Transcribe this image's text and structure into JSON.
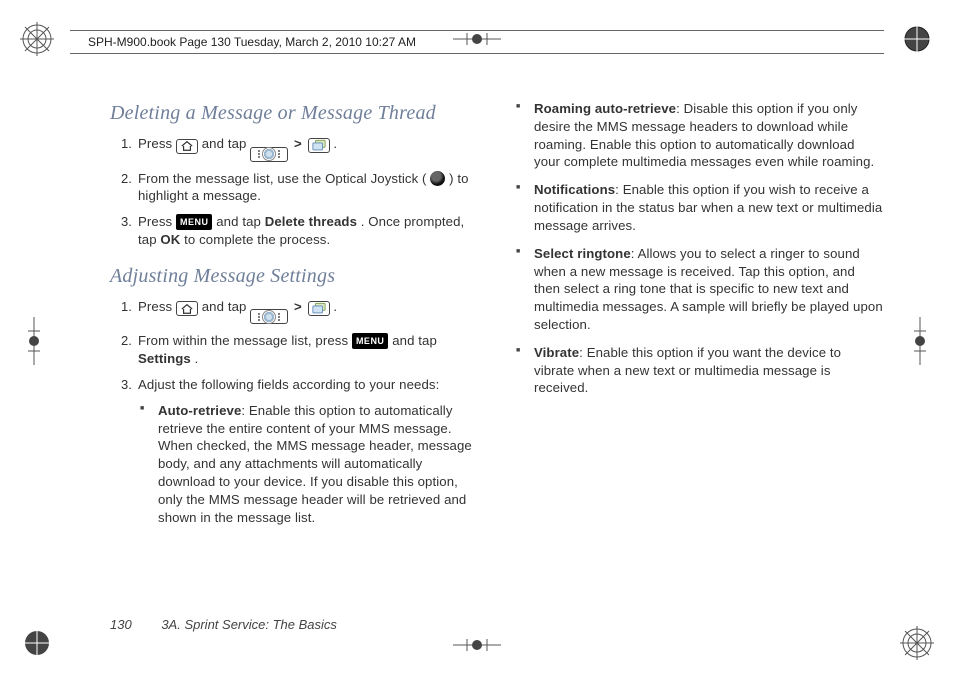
{
  "header": {
    "running_head": "SPH-M900.book  Page 130  Tuesday, March 2, 2010  10:27 AM"
  },
  "section1": {
    "title": "Deleting a Message or Message Thread",
    "steps": {
      "s1_a": "Press ",
      "s1_b": " and tap ",
      "s1_c": " > ",
      "s1_d": " .",
      "s2_a": "From the message list, use the Optical Joystick ( ",
      "s2_b": " ) to highlight a message.",
      "s3_a": "Press ",
      "s3_b": " and tap ",
      "s3_bold1": "Delete threads",
      "s3_c": ". Once prompted, tap ",
      "s3_bold2": "OK",
      "s3_d": " to complete the process."
    }
  },
  "section2": {
    "title": "Adjusting Message Settings",
    "steps": {
      "s1_a": "Press ",
      "s1_b": " and tap ",
      "s1_c": " > ",
      "s1_d": " .",
      "s2_a": "From within the message list, press ",
      "s2_b": " and tap ",
      "s2_bold": "Settings",
      "s2_c": ".",
      "s3": "Adjust the following fields according to your needs:"
    },
    "bullets_left": {
      "b1_bold": "Auto-retrieve",
      "b1_text": ": Enable this option to automatically retrieve the entire content of your MMS message. When checked, the MMS message header, message body, and any attachments will automatically download to your device. If you disable this option, only the MMS message header will be retrieved and shown in the message list."
    }
  },
  "right_bullets": {
    "b1_bold": "Roaming auto-retrieve",
    "b1_text": ": Disable this option if you only desire the MMS message headers to download while roaming. Enable this option to automatically download your complete multimedia messages even while roaming.",
    "b2_bold": "Notifications",
    "b2_text": ": Enable this option if you wish to receive a notification in the status bar when a new text or multimedia message arrives.",
    "b3_bold": "Select ringtone",
    "b3_text": ": Allows you to select a ringer to sound when a new message is received. Tap this option, and then select a ring tone that is specific to new text and multimedia messages. A sample will briefly be played upon selection.",
    "b4_bold": "Vibrate",
    "b4_text": ": Enable this option if you want the device to vibrate when a new text or multimedia message is received."
  },
  "footer": {
    "page_number": "130",
    "title": "3A. Sprint Service: The Basics"
  },
  "labels": {
    "menu": "MENU"
  }
}
